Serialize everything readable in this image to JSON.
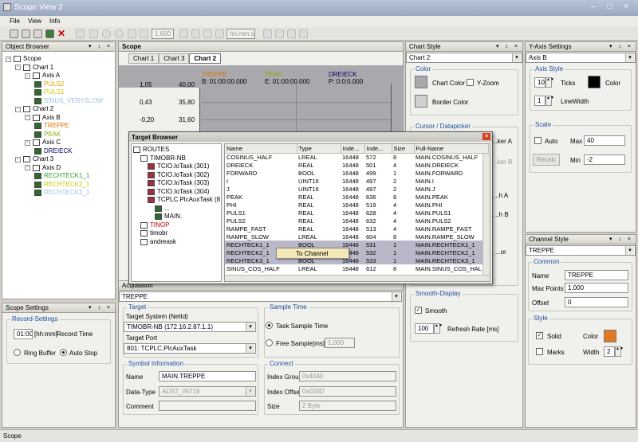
{
  "window": {
    "title": "Scope View 2",
    "controls": "– □ ×"
  },
  "menu": [
    "File",
    "View",
    "Info"
  ],
  "toolbar": {
    "field1": "1,600",
    "field2": "hh:mm:ss"
  },
  "object_browser": {
    "title": "Object Browser",
    "controls": "▾ ↕ ×",
    "items": [
      {
        "label": "Scope",
        "depth": 0,
        "color": "#000000",
        "icon": "scope-icon"
      },
      {
        "label": "Chart 1",
        "depth": 1,
        "color": "#000000",
        "icon": "chart-icon"
      },
      {
        "label": "Axis A",
        "depth": 2,
        "color": "#000000",
        "icon": "axis-icon"
      },
      {
        "label": "PULS2",
        "depth": 3,
        "color": "#e0a000",
        "icon": "channel-icon"
      },
      {
        "label": "PULS1",
        "depth": 3,
        "color": "#c8c800",
        "icon": "channel-icon"
      },
      {
        "label": "SINUS_VERYSLOW",
        "depth": 3,
        "color": "#a0c0e0",
        "icon": "channel-icon"
      },
      {
        "label": "Chart 2",
        "depth": 1,
        "color": "#000000",
        "icon": "chart-icon"
      },
      {
        "label": "Axis B",
        "depth": 2,
        "color": "#000000",
        "icon": "axis-icon"
      },
      {
        "label": "TREPPE",
        "depth": 3,
        "color": "#e07000",
        "icon": "channel-icon"
      },
      {
        "label": "PEAK",
        "depth": 3,
        "color": "#80b000",
        "icon": "channel-icon"
      },
      {
        "label": "Axis C",
        "depth": 2,
        "color": "#000000",
        "icon": "axis-icon"
      },
      {
        "label": "DREIECK",
        "depth": 3,
        "color": "#000060",
        "icon": "channel-icon"
      },
      {
        "label": "Chart 3",
        "depth": 1,
        "color": "#000000",
        "icon": "chart-icon"
      },
      {
        "label": "Axis D",
        "depth": 2,
        "color": "#000000",
        "icon": "axis-icon"
      },
      {
        "label": "RECHTECK1_1",
        "depth": 3,
        "color": "#30a030",
        "icon": "channel-icon"
      },
      {
        "label": "RECHTECK2_1",
        "depth": 3,
        "color": "#c8c800",
        "icon": "channel-icon"
      },
      {
        "label": "RECHTECK3_1",
        "depth": 3,
        "color": "#a0c0e0",
        "icon": "channel-icon"
      }
    ]
  },
  "scope_settings": {
    "title": "Scope Settings",
    "group": "Record-Settings",
    "record_time_value": "01:00",
    "record_time_unit": "[hh:mm]",
    "record_time_label": "Record Time",
    "ring_buffer": "Ring Buffer",
    "auto_stop": "Auto Stop"
  },
  "scope_tab": {
    "title": "Scope",
    "chart_tabs": [
      "Chart 1",
      "Chart 3",
      "Chart 2"
    ]
  },
  "chart": {
    "y_ticks_left": [
      "1,05",
      "0,43",
      "-0,20"
    ],
    "y_ticks_right": [
      "40,00",
      "35,80",
      "31,60"
    ],
    "legend": [
      {
        "name": "TREPPE",
        "time": "B: 01:00:00.000",
        "color": "#e07000"
      },
      {
        "name": "PEAK",
        "time": "E: 01:00:00.000",
        "color": "#80b000"
      },
      {
        "name": "DREIECK",
        "time": "P: 0:0:0.000",
        "color": "#000060"
      }
    ]
  },
  "target_browser": {
    "title": "Target Browser",
    "tree": [
      {
        "label": "ROUTES",
        "depth": 0
      },
      {
        "label": "TIMOBR-NB",
        "depth": 1
      },
      {
        "label": "TCIO.IoTask (301)",
        "depth": 2
      },
      {
        "label": "TCIO.IoTask (302)",
        "depth": 2
      },
      {
        "label": "TCIO.IoTask (303)",
        "depth": 2
      },
      {
        "label": "TCIO.IoTask (304)",
        "depth": 2
      },
      {
        "label": "TCPLC.PlcAuxTask (8",
        "depth": 2
      },
      {
        "label": "...",
        "depth": 3
      },
      {
        "label": "MAIN.",
        "depth": 3
      },
      {
        "label": "TINOP",
        "depth": 1
      },
      {
        "label": "timobr",
        "depth": 1
      },
      {
        "label": "andreask",
        "depth": 1
      }
    ],
    "columns": [
      "Name",
      "Type",
      "Inde...",
      "Inde...",
      "Size",
      "Full-Name"
    ],
    "rows": [
      [
        "COSINUS_HALF",
        "LREAL",
        "16448",
        "572",
        "8",
        "MAIN.COSINUS_HALF"
      ],
      [
        "DREIECK",
        "REAL",
        "16448",
        "501",
        "4",
        "MAIN.DREIECK"
      ],
      [
        "FORWARD",
        "BOOL",
        "16448",
        "499",
        "1",
        "MAIN.FORWARD"
      ],
      [
        "I",
        "UINT16",
        "16448",
        "497",
        "2",
        "MAIN.I"
      ],
      [
        "J",
        "UINT16",
        "16448",
        "497",
        "2",
        "MAIN.J"
      ],
      [
        "PEAK",
        "REAL",
        "16448",
        "636",
        "8",
        "MAIN.PEAK"
      ],
      [
        "PHI",
        "REAL",
        "16448",
        "519",
        "4",
        "MAIN.PHI"
      ],
      [
        "PULS1",
        "REAL",
        "16448",
        "628",
        "4",
        "MAIN.PULS1"
      ],
      [
        "PULS2",
        "REAL",
        "16448",
        "632",
        "4",
        "MAIN.PULS2"
      ],
      [
        "RAMPE_FAST",
        "REAL",
        "16448",
        "513",
        "4",
        "MAIN.RAMPE_FAST"
      ],
      [
        "RAMPE_SLOW",
        "LREAL",
        "16448",
        "604",
        "8",
        "MAIN.RAMPE_SLOW"
      ],
      [
        "RECHTECK1_1",
        "BOOL",
        "16448",
        "531",
        "1",
        "MAIN.RECHTECK1_1"
      ],
      [
        "RECHTECK2_1",
        "BOOL",
        "16448",
        "532",
        "1",
        "MAIN.RECHTECK2_1"
      ],
      [
        "RECHTECK3_1",
        "BOOL",
        "16448",
        "533",
        "1",
        "MAIN.RECHTECK3_1"
      ],
      [
        "SINUS_COS_HALF",
        "LREAL",
        "16448",
        "612",
        "8",
        "MAIN.SINUS_COS_HAL"
      ]
    ],
    "context_menu": "To Channel"
  },
  "acquisition": {
    "title": "Acquisition",
    "channel": "TREPPE",
    "target_group": "Target",
    "target_system_label": "Target System (NetId)",
    "target_system": "TIMOBR-NB (172.16.2.87.1.1)",
    "target_port_label": "Target Port",
    "target_port": "801: TCPLC.PlcAuxTask",
    "sample_group": "Sample Time",
    "task_sample": "Task Sample Time",
    "free_sample": "Free Sample",
    "free_unit": "[ms]",
    "free_value": "1,000",
    "symbol_group": "Symbol Information",
    "name_label": "Name",
    "name_value": "MAIN.TREPPE",
    "datatype_label": "Data-Type",
    "datatype_value": "ADST_INT16",
    "comment_label": "Comment",
    "connect_group": "Connect",
    "index_group_label": "Index Group",
    "index_group_value": "0x4040",
    "index_offset_label": "Index Offset",
    "index_offset_value": "0x020D",
    "size_label": "Size",
    "size_value": "2 Byte"
  },
  "chart_style": {
    "title": "Chart Style",
    "chart": "Chart 2",
    "color_group": "Color",
    "chart_color": "Chart Color",
    "y_zoom": "Y-Zoom",
    "border_color": "Border Color",
    "cursor_group": "Cursor / Datapicker",
    "cursor_a": "...ker A",
    "cursor_b": "...ker B",
    "hidden_a": "...h A",
    "hidden_b": "...h B",
    "hidden_c": "...or",
    "smooth_group": "Smooth-Display",
    "smooth": "Smooth",
    "refresh_value": "100",
    "refresh_label": "Refresh Rate [ms]"
  },
  "y_axis": {
    "title": "Y-Axis Settings",
    "axis": "Axis B",
    "style_group": "Axis Style",
    "ticks_value": "10",
    "ticks_label": "Ticks",
    "color_label": "Color",
    "linewidth_value": "1",
    "linewidth_label": "LineWidth",
    "scale_group": "Scale",
    "auto": "Auto",
    "max_label": "Max",
    "max_value": "40",
    "recalc": "Recalc",
    "min_label": "Min",
    "min_value": "-2"
  },
  "channel_style": {
    "title": "Channel Style",
    "channel": "TREPPE",
    "common_group": "Common",
    "name_label": "Name",
    "name_value": "TREPPE",
    "maxpoints_label": "Max Points",
    "maxpoints_value": "1.000",
    "offset_label": "Offset",
    "offset_value": "0",
    "style_group": "Style",
    "solid": "Solid",
    "color_label": "Color",
    "color": "#e07a20",
    "marks": "Marks",
    "width_label": "Width",
    "width_value": "2"
  },
  "status": "Scope"
}
